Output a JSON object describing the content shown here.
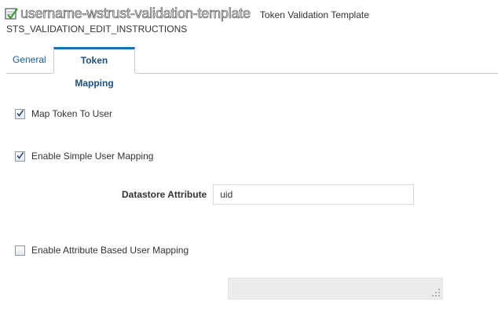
{
  "header": {
    "template_name": "username-wstrust-validation-template",
    "template_type": "Token Validation Template",
    "instructions": "STS_VALIDATION_EDIT_INSTRUCTIONS",
    "icon": "template-icon"
  },
  "tabs": [
    {
      "label": "General",
      "selected": false
    },
    {
      "label": "Token Mapping",
      "selected": true
    }
  ],
  "form": {
    "map_token_to_user": {
      "label": "Map Token To User",
      "checked": true
    },
    "enable_simple_user_mapping": {
      "label": "Enable Simple User Mapping",
      "checked": true
    },
    "datastore_attribute": {
      "label": "Datastore Attribute",
      "value": "uid"
    },
    "enable_attribute_based_user_mapping": {
      "label": "Enable Attribute Based User Mapping",
      "checked": false
    },
    "attribute_mapping_filter": {
      "value": "",
      "disabled": true
    }
  },
  "colors": {
    "tab_accent": "#1f6cb6",
    "link_blue": "#145c9e"
  }
}
